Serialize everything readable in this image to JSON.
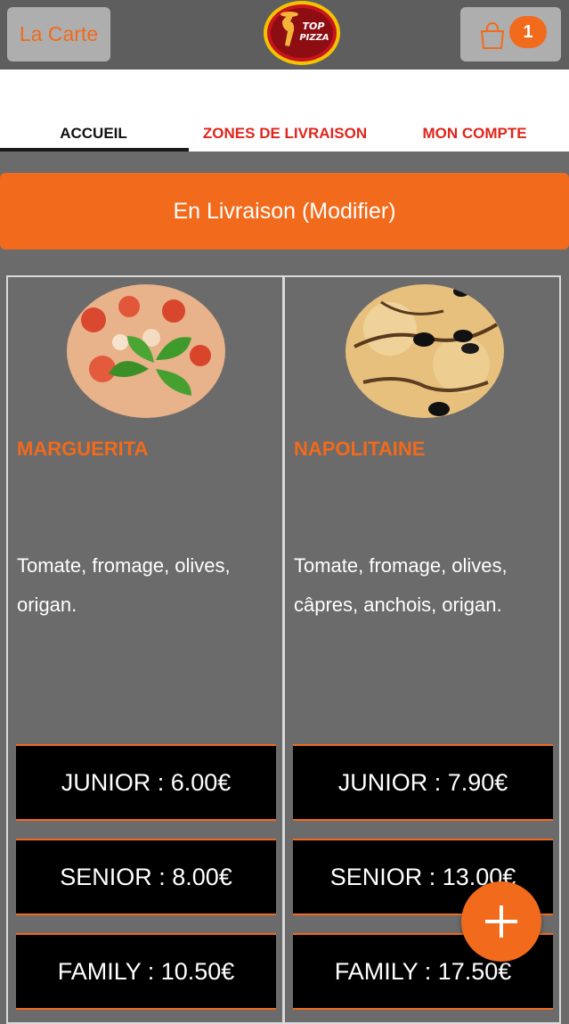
{
  "header": {
    "carte_label": "La Carte",
    "cart_count": "1",
    "logo_text_top": "TOP",
    "logo_text_bottom": "PIZZA",
    "accent_color": "#f26a1b"
  },
  "tabs": [
    {
      "label": "ACCUEIL",
      "active": true
    },
    {
      "label": "ZONES DE LIVRAISON",
      "active": false
    },
    {
      "label": "MON COMPTE",
      "active": false
    }
  ],
  "delivery_label": "En Livraison (Modifier)",
  "products": [
    {
      "name": "MARGUERITA",
      "description": "Tomate, fromage, olives, origan.",
      "prices": [
        "JUNIOR : 6.00€",
        "SENIOR : 8.00€",
        "FAMILY : 10.50€"
      ]
    },
    {
      "name": "NAPOLITAINE",
      "description": "Tomate, fromage, olives, câpres, anchois, origan.",
      "prices": [
        "JUNIOR : 7.90€",
        "SENIOR : 13.00€",
        "FAMILY : 17.50€"
      ]
    }
  ],
  "icons": {
    "cart": "shopping-bag-icon",
    "fab": "plus-icon"
  }
}
